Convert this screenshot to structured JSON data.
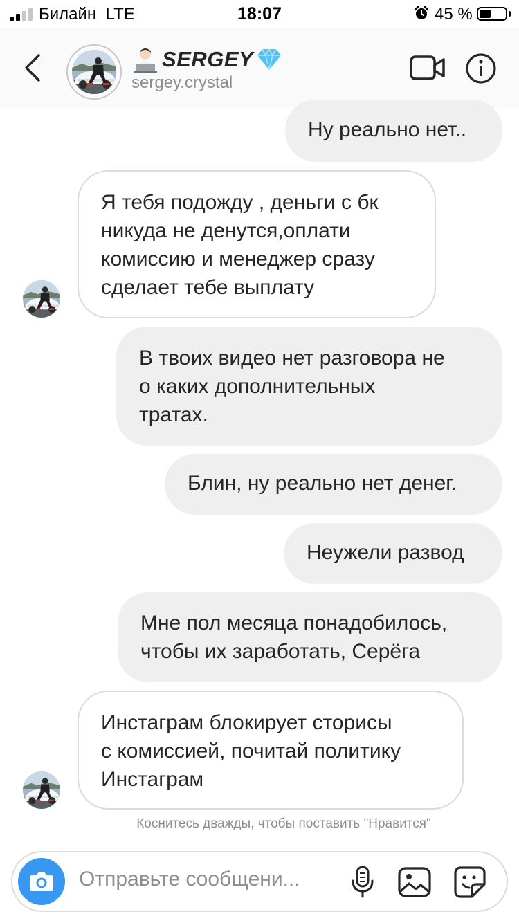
{
  "status_bar": {
    "carrier": "Билайн",
    "network": "LTE",
    "time": "18:07",
    "battery_percent": "45 %",
    "battery_level": 0.45,
    "icons": [
      "signal-icon",
      "alarm-icon",
      "battery-icon"
    ]
  },
  "header": {
    "display_name": "SERGEY",
    "name_prefix_emoji": "🧑🏻‍💻",
    "name_suffix_emoji": "💎",
    "username": "sergey.crystal",
    "icons": [
      "back-icon",
      "video-call-icon",
      "info-icon"
    ]
  },
  "messages": [
    {
      "direction": "sent",
      "text": "Ну реально нет.."
    },
    {
      "direction": "received",
      "text": "Я тебя подожду , деньги с бк\nникуда не денутся,оплати\nкомиссию и менеджер сразу\nсделает тебе выплату"
    },
    {
      "direction": "sent",
      "text": "В твоих видео нет разговора не\nо каких дополнительных\nтратах."
    },
    {
      "direction": "sent",
      "text": "Блин, ну реально нет денег."
    },
    {
      "direction": "sent",
      "text": "Неужели развод"
    },
    {
      "direction": "sent",
      "text": "Мне пол месяца понадобилось,\nчтобы их заработать, Серёга"
    },
    {
      "direction": "received",
      "text": "Инстаграм блокирует сторисы\nс комиссией, почитай политику\nИнстаграм"
    }
  ],
  "like_hint": "Коснитесь дважды, чтобы поставить \"Нравится\"",
  "composer": {
    "placeholder": "Отправьте сообщени...",
    "icons": [
      "camera-icon",
      "microphone-icon",
      "gallery-icon",
      "sticker-icon"
    ]
  },
  "colors": {
    "accent": "#3897f0",
    "sent_bubble": "#efefef",
    "received_border": "#dbdbdb",
    "secondary_text": "#8e8e8e",
    "verified_gem": "#4fc3f7"
  }
}
